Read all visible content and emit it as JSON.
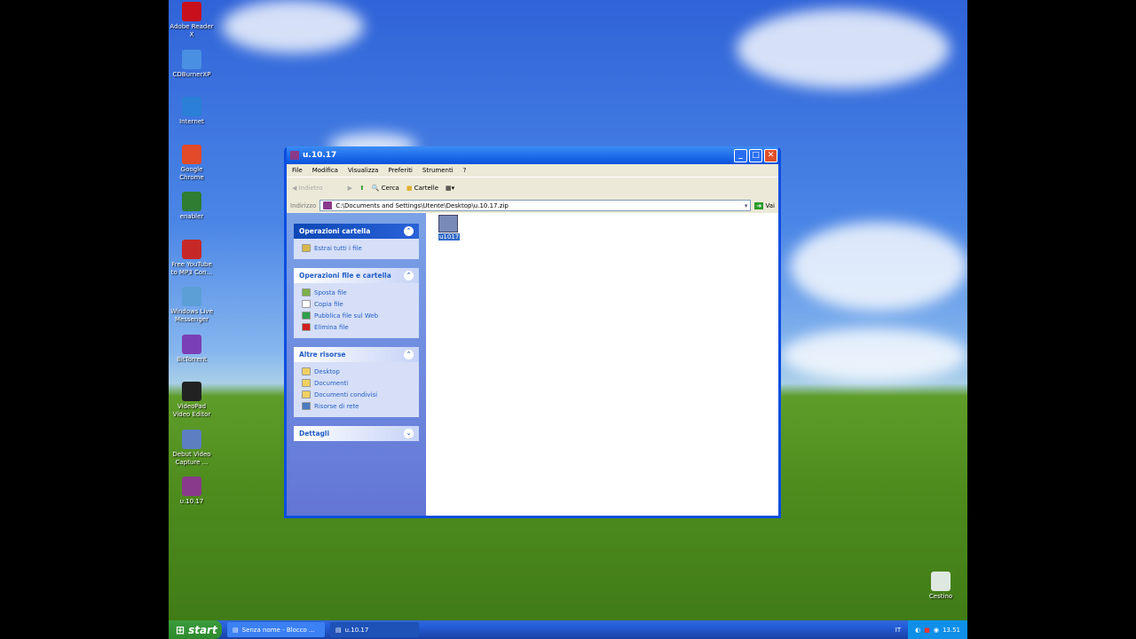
{
  "desktop": {
    "icons": [
      {
        "label": "Adobe Reader X",
        "color": "#c8101c"
      },
      {
        "label": "CDBurnerXP",
        "color": "#4a90e2"
      },
      {
        "label": "Internet",
        "color": "#2a7fd6"
      },
      {
        "label": "Google Chrome",
        "color": "#e24a2a"
      },
      {
        "label": "enabler",
        "color": "#2e7d32"
      },
      {
        "label": "Free YouTube to MP3 Con...",
        "color": "#c62828"
      },
      {
        "label": "Windows Live Messenger",
        "color": "#5c9ed6"
      },
      {
        "label": "BitTorrent",
        "color": "#7b3fb5"
      },
      {
        "label": "VideoPad Video Editor",
        "color": "#222222"
      },
      {
        "label": "Debut Video Capture ...",
        "color": "#5b7fc0"
      },
      {
        "label": "u.10.17",
        "color": "#8a3a8a"
      }
    ],
    "recycle_bin": "Cestino"
  },
  "window": {
    "title": "u.10.17",
    "menu": [
      "File",
      "Modifica",
      "Visualizza",
      "Preferiti",
      "Strumenti",
      "?"
    ],
    "toolbar": {
      "back": "Indietro",
      "search": "Cerca",
      "folders": "Cartelle"
    },
    "address": {
      "label": "Indirizzo",
      "value": "C:\\Documents and Settings\\Utente\\Desktop\\u.10.17.zip",
      "go": "Vai"
    },
    "panels": [
      {
        "title": "Operazioni cartella",
        "items": [
          {
            "label": "Estrai tutti i file",
            "color": "#d8b84a"
          }
        ]
      },
      {
        "title": "Operazioni file e cartella",
        "items": [
          {
            "label": "Sposta file",
            "color": "#7bb04a"
          },
          {
            "label": "Copia file",
            "color": "#ffffff"
          },
          {
            "label": "Pubblica file sul Web",
            "color": "#2e9e4a"
          },
          {
            "label": "Elimina file",
            "color": "#d02020"
          }
        ]
      },
      {
        "title": "Altre risorse",
        "items": [
          {
            "label": "Desktop",
            "color": "#f0d060"
          },
          {
            "label": "Documenti",
            "color": "#f0d060"
          },
          {
            "label": "Documenti condivisi",
            "color": "#f0d060"
          },
          {
            "label": "Risorse di rete",
            "color": "#4a7ac0"
          }
        ]
      },
      {
        "title": "Dettagli",
        "items": []
      }
    ],
    "file": {
      "name": "u1017"
    }
  },
  "taskbar": {
    "start": "start",
    "tasks": [
      "Senza nome - Blocco ...",
      "u.10.17"
    ],
    "lang": "IT",
    "clock": "13.51"
  }
}
